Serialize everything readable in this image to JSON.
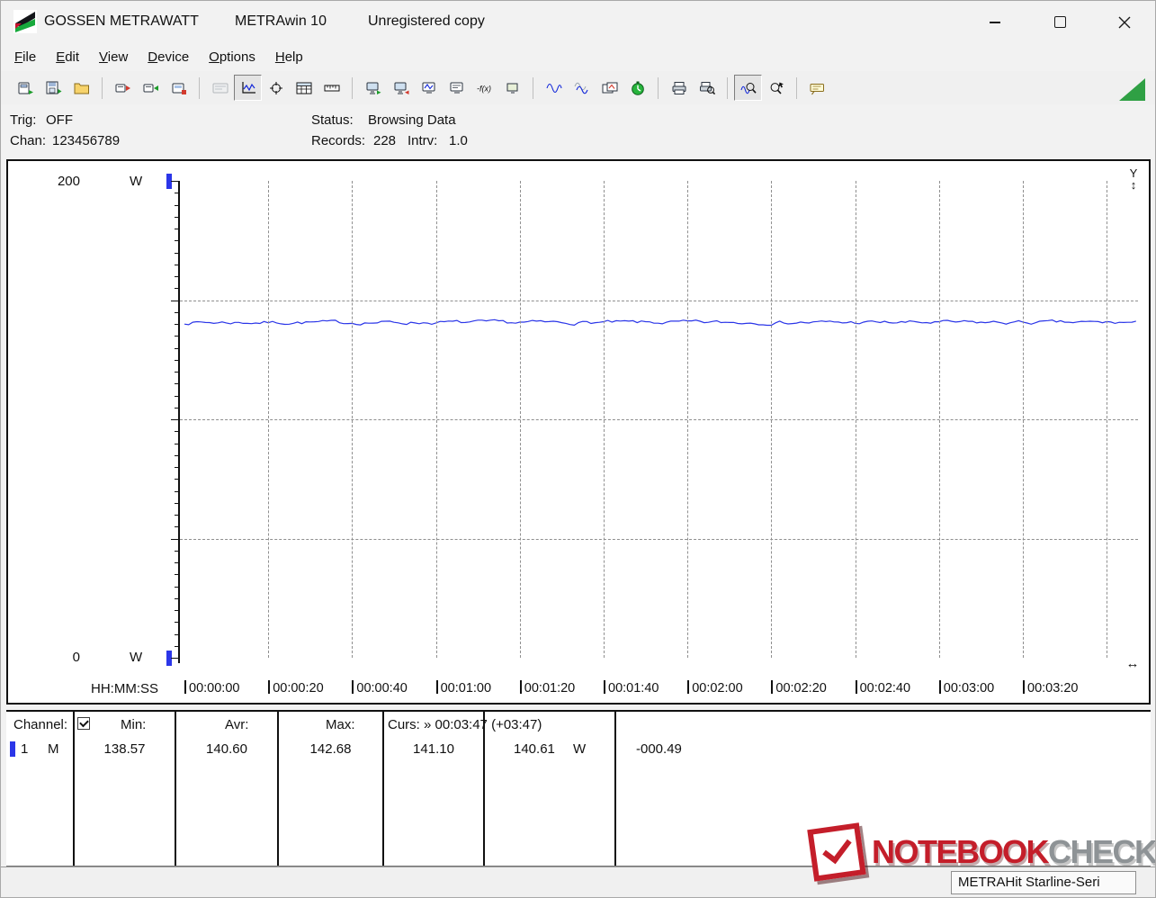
{
  "window": {
    "app_title": "GOSSEN METRAWATT",
    "program_title": "METRAwin 10",
    "license_note": "Unregistered copy"
  },
  "menu": {
    "items": [
      "File",
      "Edit",
      "View",
      "Device",
      "Options",
      "Help"
    ]
  },
  "toolbar": {
    "button_icons": [
      "load-from-device-icon",
      "save-data-icon",
      "open-file-icon",
      "send-to-device-icon",
      "receive-from-device-icon",
      "device-memory-icon",
      "multimeter-display-icon",
      "chart-view-icon",
      "cursor-crosshair-icon",
      "table-view-icon",
      "scale-view-icon",
      "online-output-icon",
      "online-input-icon",
      "online-chart-icon",
      "monitor-view-icon",
      "formula-icon",
      "monitor-small-icon",
      "waveform-icon",
      "envelope-icon",
      "compare-charts-icon",
      "timer-icon",
      "print-icon",
      "print-preview-icon",
      "zoom-chart-icon",
      "zoom-select-icon",
      "annotation-icon"
    ]
  },
  "status_panel": {
    "trig": {
      "label": "Trig:",
      "value": "OFF"
    },
    "chan": {
      "label": "Chan:",
      "value": "123456789"
    },
    "status": {
      "label": "Status:",
      "value": "Browsing Data"
    },
    "records": {
      "label": "Records:",
      "value": "228"
    },
    "intrv": {
      "label": "Intrv:",
      "value": "1.0"
    }
  },
  "chart_data": {
    "type": "line",
    "y_axis": {
      "unit": "W",
      "max_label": "200",
      "min_label": "0"
    },
    "ylim": [
      0,
      200
    ],
    "grid_y": [
      150,
      100,
      50
    ],
    "x_axis_label": "HH:MM:SS",
    "x_ticks": [
      "00:00:00",
      "00:00:20",
      "00:00:40",
      "00:01:00",
      "00:01:20",
      "00:01:40",
      "00:02:00",
      "00:02:20",
      "00:02:40",
      "00:03:00",
      "00:03:20"
    ],
    "x_tick_interval_s": 20,
    "records": 228,
    "interval_s": 1.0,
    "series": [
      {
        "name": "channel-1-power-W",
        "color": "#2b36e8",
        "stats": {
          "min": 138.57,
          "avg": 140.6,
          "max": 142.68
        }
      }
    ],
    "cursor": {
      "time": "00:03:47",
      "elapsed": "+03:47",
      "value_a": 141.1,
      "value_b": 140.61,
      "delta": -0.49
    },
    "grid": true,
    "legend_position": "none"
  },
  "axis_handles": {
    "y_label": "Y",
    "y_arrow": "↕",
    "x_arrow": "↔"
  },
  "table": {
    "header": {
      "channel": "Channel:",
      "min": "Min:",
      "avr": "Avr:",
      "max": "Max:",
      "curs": "Curs: » 00:03:47 (+03:47)"
    },
    "row": {
      "num": "1",
      "mode": "M",
      "min": "138.57",
      "avr": "140.60",
      "max": "142.68",
      "cursor_value": "141.10",
      "live_value": "140.61",
      "live_unit": "W",
      "delta": "-000.49"
    }
  },
  "statusbar": {
    "device": "METRAHit Starline-Seri"
  },
  "watermark": {
    "word1": "NOTEBOOK",
    "word2": "CHECK"
  }
}
